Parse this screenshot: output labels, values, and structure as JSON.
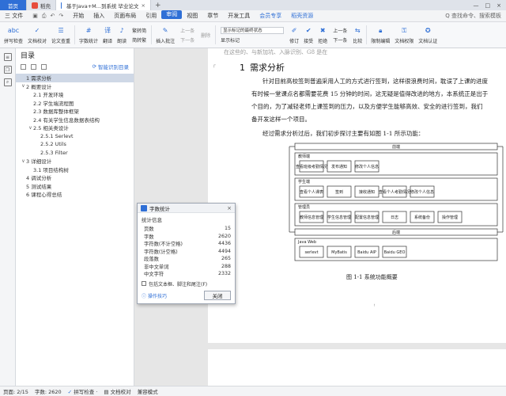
{
  "tabs": {
    "home": "首页",
    "daoke": "稻壳",
    "doc": "基于Java+M...到系统 毕业论文",
    "plus": "+"
  },
  "menu": {
    "file": "三 文件",
    "items": [
      "开始",
      "插入",
      "页面布局",
      "引用",
      "审阅",
      "视图",
      "章节",
      "开发工具",
      "会员专享",
      "稻壳资源"
    ],
    "active_index": 4,
    "search": "Q 查找命令、搜索模板"
  },
  "ribbon": {
    "spell": "拼写检查",
    "doc_check": "文档校对",
    "paper_check": "论文查重",
    "word_count": "字数统计",
    "translate": "翻译",
    "read_aloud": "朗读",
    "jian_fan": "繁转简",
    "fan_jian": "简转繁",
    "insert_comment": "插入批注",
    "prev": "上一条",
    "next": "下一条",
    "delete": "删除",
    "show_markup_select": "显示标记的最终状态",
    "show_markup": "显示标记",
    "revise": "修订",
    "accept": "接受",
    "reject": "拒绝",
    "prev2": "上一条",
    "next2": "下一条",
    "compare": "比较",
    "restrict": "限制编辑",
    "doc_rights": "文档权限",
    "doc_auth": "文档认证"
  },
  "toc": {
    "title": "目录",
    "smart": "智能识别目录",
    "items": [
      {
        "text": "1 需求分析",
        "indent": 0,
        "twisty": "",
        "selected": true
      },
      {
        "text": "2 概要设计",
        "indent": 0,
        "twisty": "∨"
      },
      {
        "text": "2.1 开发环境",
        "indent": 1,
        "twisty": ""
      },
      {
        "text": "2.2 学生端流程图",
        "indent": 1,
        "twisty": ""
      },
      {
        "text": "2.3 数据库整体框架",
        "indent": 1,
        "twisty": ""
      },
      {
        "text": "2.4 有关学生信息数据表结构",
        "indent": 1,
        "twisty": ""
      },
      {
        "text": "2.5 相关类设计",
        "indent": 1,
        "twisty": "∨"
      },
      {
        "text": "2.5.1 Serlevt",
        "indent": 2,
        "twisty": ""
      },
      {
        "text": "2.5.2 Utils",
        "indent": 2,
        "twisty": ""
      },
      {
        "text": "2.5.3 Filter",
        "indent": 2,
        "twisty": ""
      },
      {
        "text": "3 详细设计",
        "indent": 0,
        "twisty": "∨"
      },
      {
        "text": "3.1 项目结构树",
        "indent": 1,
        "twisty": ""
      },
      {
        "text": "4 调试分析",
        "indent": 0,
        "twisty": ""
      },
      {
        "text": "5 测试结果",
        "indent": 0,
        "twisty": ""
      },
      {
        "text": "6 课程心得总结",
        "indent": 0,
        "twisty": ""
      }
    ]
  },
  "document": {
    "cut_line": "在这些的、与新加坑、入脉识别、G8 是在",
    "heading_num": "1",
    "heading_text": "需求分析",
    "para1": [
      "针对目前高校签到普遍采用人工的方式进行签到，这样很浪费时间，耽误了上课的进度",
      "有时候一堂课点名都需要花费 15 分钟的时间，这无疑是值得改进的地方，本系统正是出于",
      "个目的，为了减轻老师上课签到的压力，以及方便学生能够高效、安全的进行签到，我们",
      "备开发这样一个项目。"
    ],
    "para2": "经过需求分析过后，我们初步探讨主要有如图 1-1 所示功能：",
    "caption": "图 1-1  系统功能概要"
  },
  "diagram": {
    "top_label": "前端",
    "groups": [
      {
        "title": "教师端",
        "boxes": [
          "查看班级考勤情况",
          "发布通知",
          "修改个人信息"
        ]
      },
      {
        "title": "学生端",
        "boxes": [
          "查看个人课表",
          "签到",
          "接收通知",
          "查看个人考勤情况",
          "修改个人信息"
        ]
      },
      {
        "title": "管理员",
        "boxes": [
          "教师信息管理",
          "学生信息管理",
          "配置信息管理",
          "日志",
          "系统备份",
          "操作管理"
        ]
      }
    ],
    "backend_label": "后端",
    "java_web_title": "Java Web",
    "java_web_boxes": [
      "serlevt",
      "MyBatis",
      "Baidu AIP",
      "Baidu GEO"
    ]
  },
  "dialog": {
    "title": "字数统计",
    "section": "统计信息",
    "stats": [
      {
        "label": "页数",
        "value": "15"
      },
      {
        "label": "字数",
        "value": "2620"
      },
      {
        "label": "字符数(不计空格)",
        "value": "4436"
      },
      {
        "label": "字符数(计空格)",
        "value": "4494"
      },
      {
        "label": "段落数",
        "value": "265"
      },
      {
        "label": "非中文单词",
        "value": "288"
      },
      {
        "label": "中文字符",
        "value": "2332"
      }
    ],
    "checkbox": "包括文本框、脚注和尾注(F)",
    "tips": "操作技巧",
    "close": "关闭"
  },
  "status": {
    "page": "页面: 2/15",
    "words": "字数: 2620",
    "spell": "拼写检查 ·",
    "proof": "文档校对",
    "compat": "兼容模式"
  }
}
